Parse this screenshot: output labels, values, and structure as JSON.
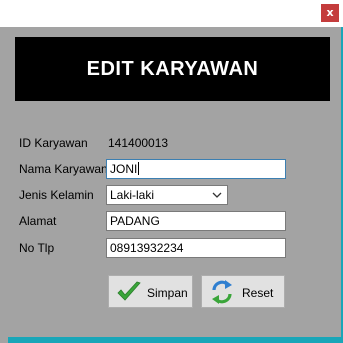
{
  "window": {
    "close_glyph": "x",
    "banner_title": "EDIT KARYAWAN"
  },
  "form": {
    "id_label": "ID Karyawan",
    "id_value": "141400013",
    "name_label": "Nama Karyawan",
    "name_value": "JONI",
    "gender_label": "Jenis Kelamin",
    "gender_value": "Laki-laki",
    "address_label": "Alamat",
    "address_value": "PADANG",
    "phone_label": "No Tlp",
    "phone_value": "08913932234"
  },
  "buttons": {
    "save_label": "Simpan",
    "save_icon": "check-icon",
    "reset_label": "Reset",
    "reset_icon": "refresh-icon"
  },
  "colors": {
    "background_accent": "#19a6b8",
    "dialog_body": "#a3a3a3",
    "banner": "#000000",
    "close_button": "#c43c3c",
    "check_green": "#3aa53a",
    "refresh_blue": "#2f7fd0"
  }
}
